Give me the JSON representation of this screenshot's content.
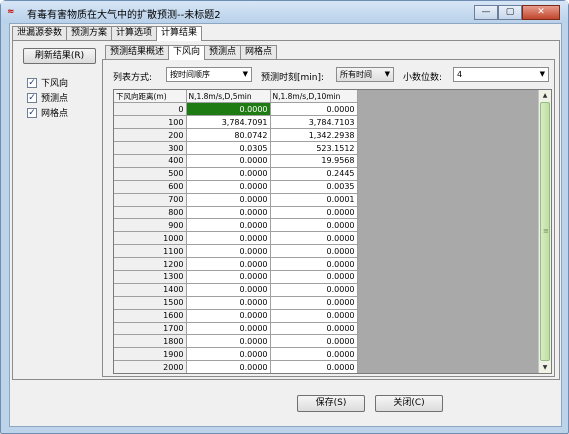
{
  "window": {
    "title": "有毒有害物质在大气中的扩散预测--未标题2",
    "minimize_glyph": "—",
    "maximize_glyph": "▢",
    "close_glyph": "✕"
  },
  "outer_tabs": [
    "泄漏源参数",
    "预测方案",
    "计算选项",
    "计算结果"
  ],
  "outer_active_tab": "计算结果",
  "left_panel": {
    "refresh_label": "刷新结果(R)",
    "checkboxes": [
      {
        "label": "下风向",
        "checked": true
      },
      {
        "label": "预测点",
        "checked": true
      },
      {
        "label": "网格点",
        "checked": true
      }
    ]
  },
  "inner_tabs": [
    "预测结果概述",
    "下风向",
    "预测点",
    "网格点"
  ],
  "inner_active_tab": "下风向",
  "options": {
    "list_mode_label": "列表方式:",
    "list_mode_value": "按时间顺序",
    "time_label": "预测时刻[min]:",
    "time_value": "所有时间",
    "decimals_label": "小数位数:",
    "decimals_value": "4"
  },
  "table": {
    "headers": [
      "下风向距离(m)",
      "N,1.8m/s,D,5min",
      "N,1.8m/s,D,10min"
    ],
    "rows": [
      [
        "0",
        "0.0000",
        "0.0000"
      ],
      [
        "100",
        "3,784.7091",
        "3,784.7103"
      ],
      [
        "200",
        "80.0742",
        "1,342.2938"
      ],
      [
        "300",
        "0.0305",
        "523.1512"
      ],
      [
        "400",
        "0.0000",
        "19.9568"
      ],
      [
        "500",
        "0.0000",
        "0.2445"
      ],
      [
        "600",
        "0.0000",
        "0.0035"
      ],
      [
        "700",
        "0.0000",
        "0.0001"
      ],
      [
        "800",
        "0.0000",
        "0.0000"
      ],
      [
        "900",
        "0.0000",
        "0.0000"
      ],
      [
        "1000",
        "0.0000",
        "0.0000"
      ],
      [
        "1100",
        "0.0000",
        "0.0000"
      ],
      [
        "1200",
        "0.0000",
        "0.0000"
      ],
      [
        "1300",
        "0.0000",
        "0.0000"
      ],
      [
        "1400",
        "0.0000",
        "0.0000"
      ],
      [
        "1500",
        "0.0000",
        "0.0000"
      ],
      [
        "1600",
        "0.0000",
        "0.0000"
      ],
      [
        "1700",
        "0.0000",
        "0.0000"
      ],
      [
        "1800",
        "0.0000",
        "0.0000"
      ],
      [
        "1900",
        "0.0000",
        "0.0000"
      ],
      [
        "2000",
        "0.0000",
        "0.0000"
      ]
    ],
    "selected_cell_color": "#1e7a12"
  },
  "buttons": {
    "save": "保存(S)",
    "close": "关闭(C)"
  },
  "icons": {
    "app": "app-icon",
    "combo_arrow": "chevron-down-icon",
    "checkbox_mark": "checkmark-icon"
  },
  "scroll_glyphs": {
    "up": "▲",
    "down": "▼",
    "grip": "≡"
  },
  "glyphs": {
    "combo_arrow": "▼",
    "check": "✓",
    "app": "≈"
  }
}
